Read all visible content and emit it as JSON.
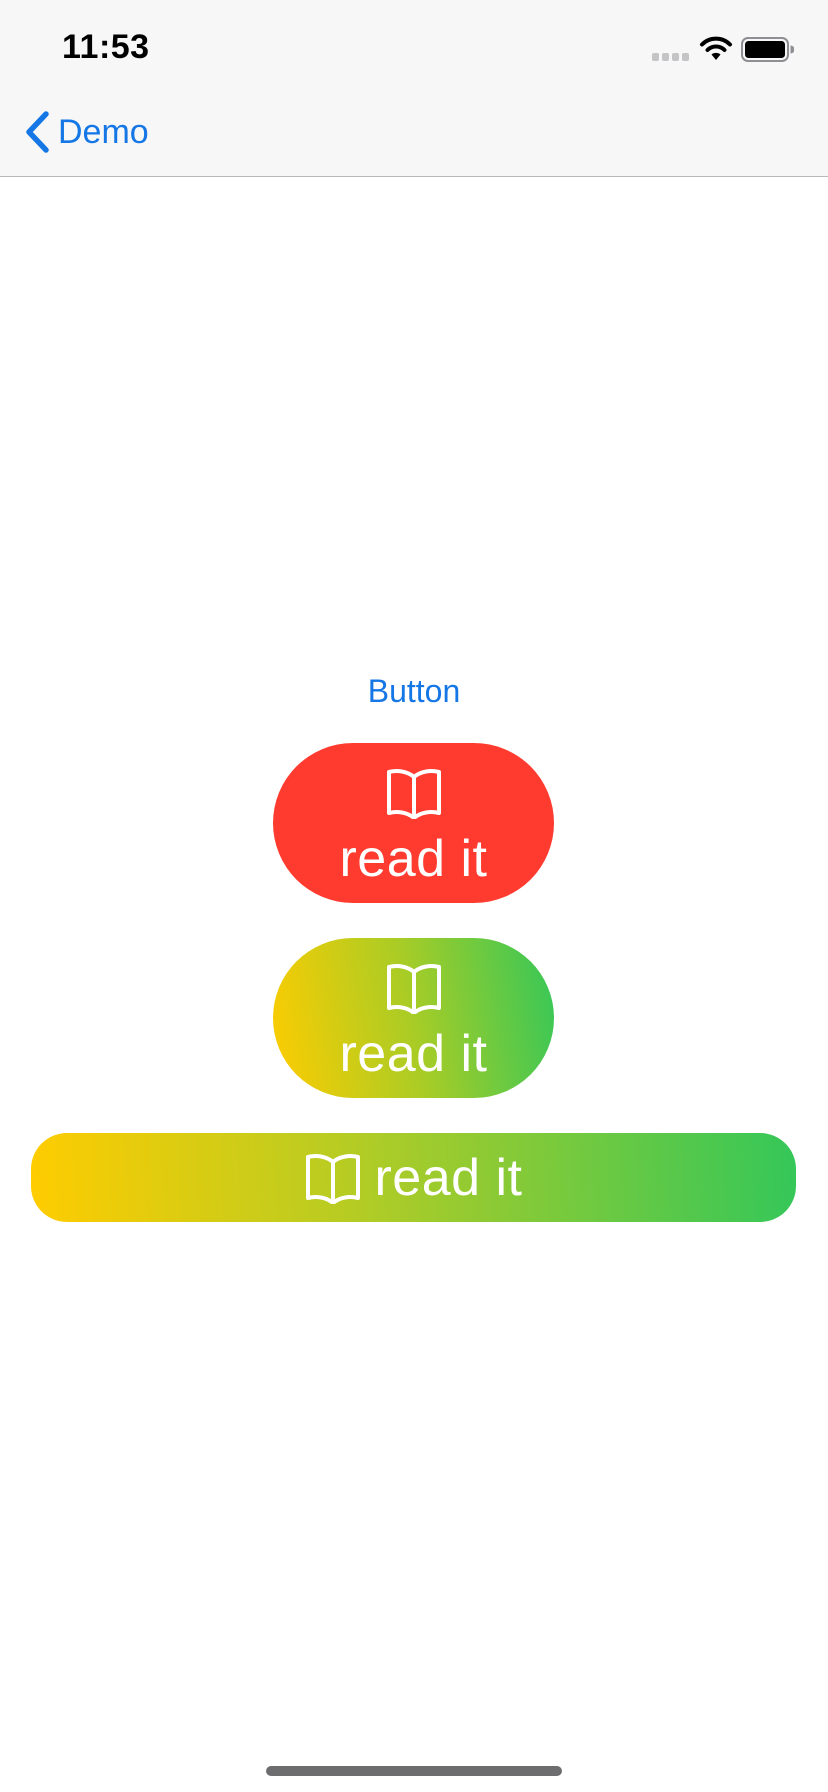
{
  "status_bar": {
    "time": "11:53",
    "icons": [
      "signal-dots-icon",
      "wifi-icon",
      "battery-icon"
    ]
  },
  "nav_bar": {
    "back_label": "Demo",
    "back_icon": "chevron-left-icon"
  },
  "content": {
    "plain_button_label": "Button",
    "buttons": [
      {
        "label": "read it",
        "icon": "book-icon",
        "style": "red",
        "color": "#ff3b30"
      },
      {
        "label": "read it",
        "icon": "book-icon",
        "style": "gradient",
        "gradient_from": "#ffcc00",
        "gradient_to": "#34c759"
      },
      {
        "label": "read it",
        "icon": "book-icon",
        "style": "gradient-wide",
        "gradient_from": "#ffcc00",
        "gradient_to": "#34c759"
      }
    ]
  },
  "colors": {
    "accent": "#1477e5",
    "red": "#ff3b30",
    "yellow": "#ffcc00",
    "green": "#34c759"
  }
}
